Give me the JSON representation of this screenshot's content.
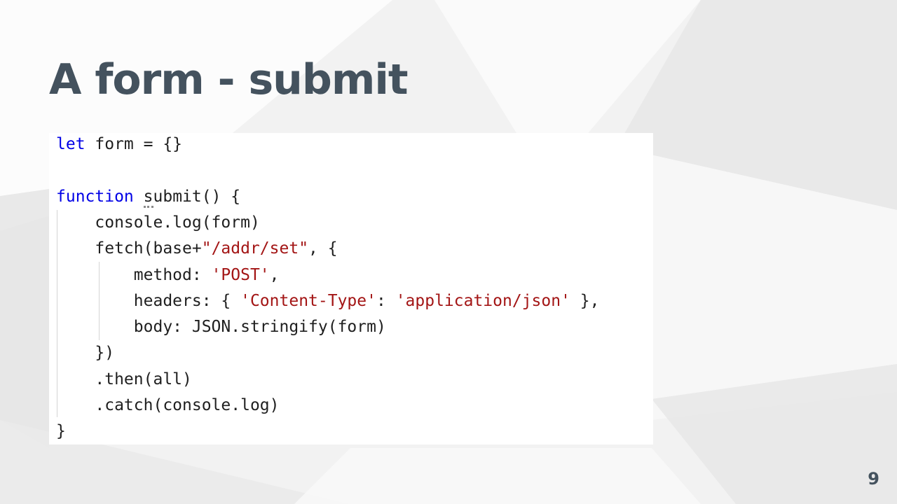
{
  "slide": {
    "title": "A form - submit",
    "page_number": "9"
  },
  "code": {
    "lines": [
      [
        {
          "text": "let",
          "kind": "keyword"
        },
        {
          "text": " form = {}",
          "kind": "plain"
        }
      ],
      [
        {
          "text": "",
          "kind": "plain"
        }
      ],
      [
        {
          "text": "function",
          "kind": "keyword"
        },
        {
          "text": " ",
          "kind": "plain"
        },
        {
          "text": "s",
          "kind": "squiggle"
        },
        {
          "text": "ubmit() {",
          "kind": "plain"
        }
      ],
      [
        {
          "text": "    console.log(form)",
          "kind": "plain"
        }
      ],
      [
        {
          "text": "    fetch(base+",
          "kind": "plain"
        },
        {
          "text": "\"/addr/set\"",
          "kind": "string"
        },
        {
          "text": ", {",
          "kind": "plain"
        }
      ],
      [
        {
          "text": "        method: ",
          "kind": "plain"
        },
        {
          "text": "'POST'",
          "kind": "string"
        },
        {
          "text": ",",
          "kind": "plain"
        }
      ],
      [
        {
          "text": "        headers: { ",
          "kind": "plain"
        },
        {
          "text": "'Content-Type'",
          "kind": "string"
        },
        {
          "text": ": ",
          "kind": "plain"
        },
        {
          "text": "'application/json'",
          "kind": "string"
        },
        {
          "text": " },",
          "kind": "plain"
        }
      ],
      [
        {
          "text": "        body: JSON.stringify(form)",
          "kind": "plain"
        }
      ],
      [
        {
          "text": "    })",
          "kind": "plain"
        }
      ],
      [
        {
          "text": "    .then(all)",
          "kind": "plain"
        }
      ],
      [
        {
          "text": "    .catch(console.log)",
          "kind": "plain"
        }
      ],
      [
        {
          "text": "}",
          "kind": "plain"
        }
      ]
    ]
  },
  "colors": {
    "title": "#44525e",
    "keyword": "#0000e6",
    "string": "#a31515",
    "code_text": "#1f1f1f",
    "code_background": "#ffffff"
  }
}
